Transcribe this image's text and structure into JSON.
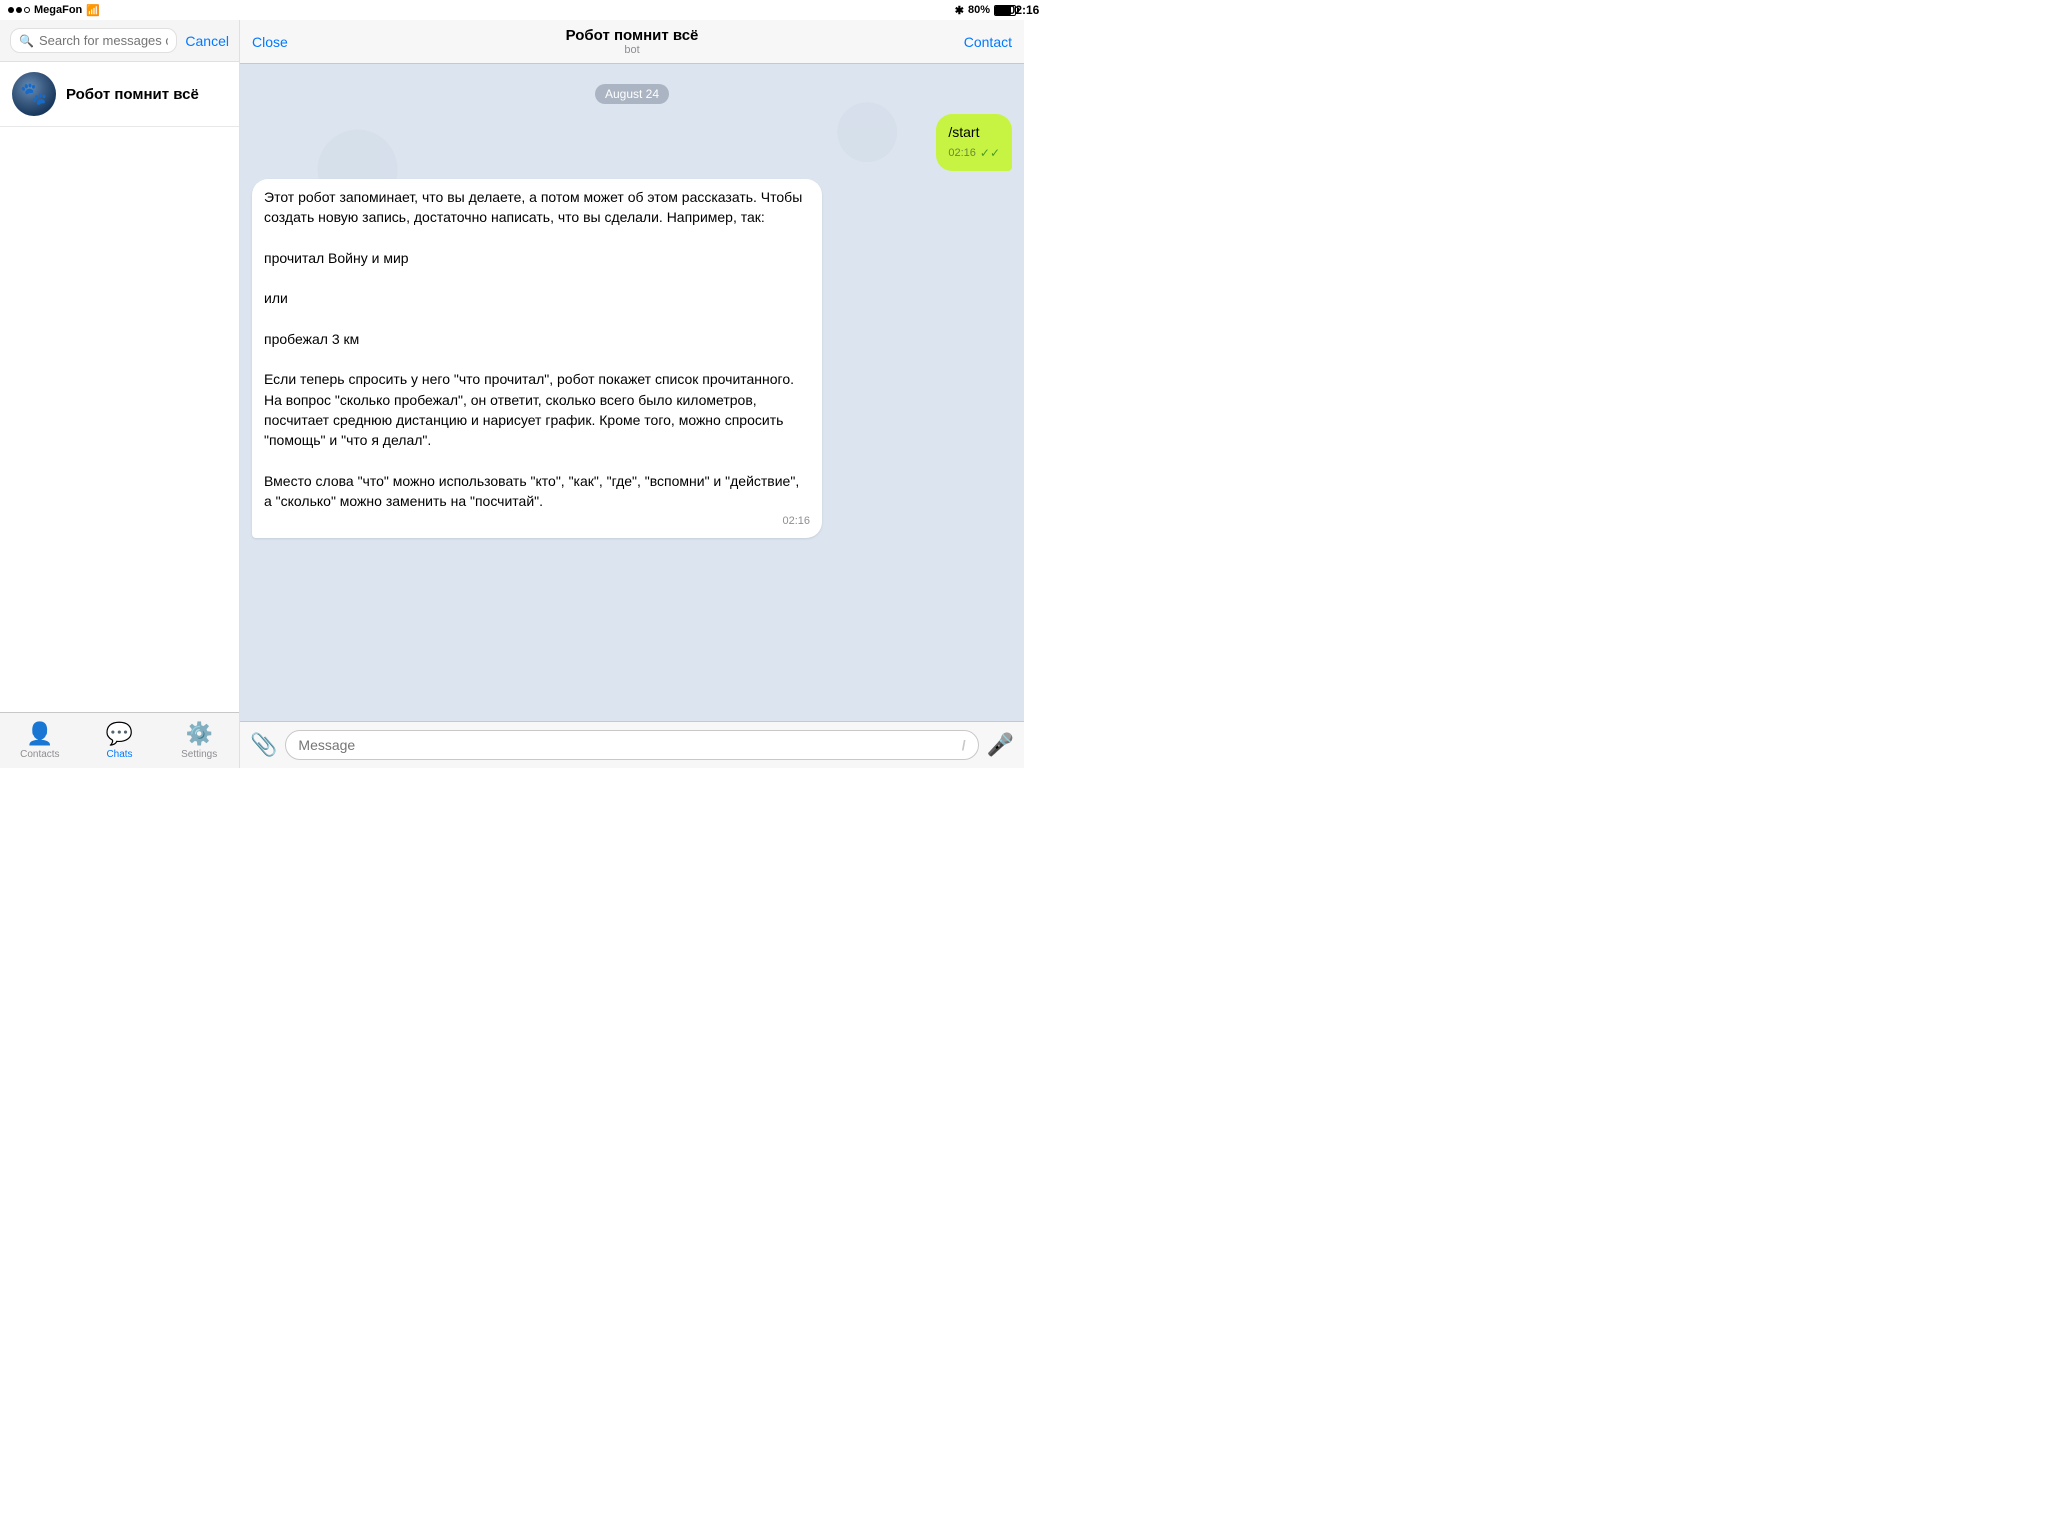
{
  "status_bar": {
    "carrier": "MegaFon",
    "time": "02:16",
    "battery": "80%",
    "battery_level": 80
  },
  "left_panel": {
    "search": {
      "placeholder": "Search for messages or users",
      "cancel_label": "Cancel"
    },
    "chat_list": [
      {
        "name": "Робот помнит всё",
        "avatar_emoji": "🤖"
      }
    ]
  },
  "tab_bar": {
    "tabs": [
      {
        "label": "Contacts",
        "icon": "👤",
        "active": false
      },
      {
        "label": "Chats",
        "icon": "💬",
        "active": true
      },
      {
        "label": "Settings",
        "icon": "⚙️",
        "active": false
      }
    ]
  },
  "chat_header": {
    "close_label": "Close",
    "title": "Робот помнит всё",
    "subtitle": "bot",
    "contact_label": "Contact"
  },
  "messages": {
    "date_badge": "August 24",
    "outgoing": {
      "text": "/start",
      "time": "02:16",
      "read": true
    },
    "incoming": {
      "text": "Этот робот запоминает, что вы делаете, а потом может об этом рассказать. Чтобы создать новую запись, достаточно написать, что вы сделали. Например, так:\n\nпрочитал Войну и мир\n\nили\n\nпробежал 3 км\n\nЕсли теперь спросить у него \"что прочитал\", робот покажет список прочитанного. На вопрос \"сколько пробежал\", он ответит, сколько всего было километров, посчитает среднюю дистанцию и нарисует график. Кроме того, можно спросить \"помощь\" и \"что я делал\".\n\nВместо слова \"что\" можно использовать \"кто\", \"как\", \"где\", \"вспомни\" и \"действие\", а \"сколько\" можно заменить на \"посчитай\".",
      "time": "02:16"
    }
  },
  "input_area": {
    "placeholder": "Message",
    "slash": "/"
  }
}
